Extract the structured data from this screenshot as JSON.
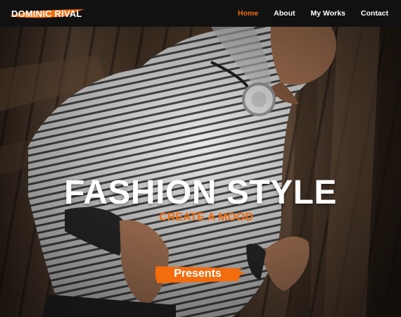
{
  "nav": {
    "logo_text": "DOMINIC RIVAL",
    "items": [
      {
        "label": "Home",
        "active": true
      },
      {
        "label": "About",
        "active": false
      },
      {
        "label": "My Works",
        "active": false
      },
      {
        "label": "Contact",
        "active": false
      }
    ]
  },
  "hero": {
    "headline": "FASHION STYLE",
    "tagline": "CREATE A MOOD",
    "cta_label": "Presents"
  },
  "colors": {
    "accent": "#f36c0d",
    "nav_bg": "#111111",
    "text": "#ffffff"
  }
}
